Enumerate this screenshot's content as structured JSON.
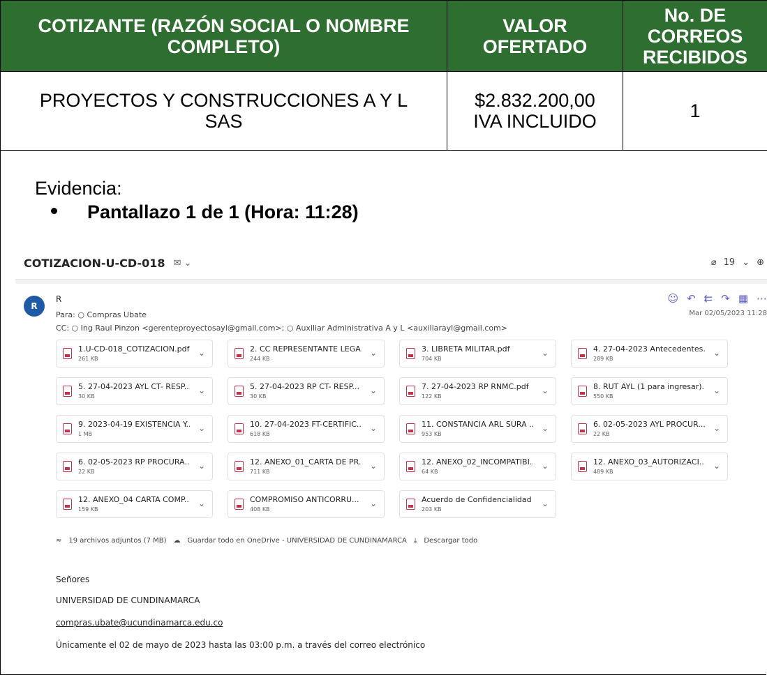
{
  "table": {
    "headers": [
      "COTIZANTE (RAZÓN SOCIAL O NOMBRE COMPLETO)",
      "VALOR OFERTADO",
      "No. DE CORREOS RECIBIDOS"
    ],
    "row": {
      "cotizante": "PROYECTOS Y CONSTRUCCIONES A Y L SAS",
      "valor": "$2.832.200,00 IVA INCLUIDO",
      "correos": "1"
    }
  },
  "evidencia_label": "Evidencia:",
  "bullet": "Pantallazo 1 de 1 (Hora: 11:28)",
  "email": {
    "subject": "COTIZACION-U-CD-018",
    "subject_icon": "envelope-tag-icon",
    "attach_count": "19",
    "avatar_initial": "R",
    "sender": "R",
    "to": "Para: ○ Compras Ubate",
    "cc": "CC: ○ Ing Raul Pinzon <gerenteproyectosayl@gmail.com>; ○ Auxiliar Administrativa A y L <auxiliarayl@gmail.com>",
    "date": "Mar 02/05/2023 11:28",
    "attachments": [
      {
        "name": "1.U-CD-018_COTIZACION.pdf",
        "size": "261 KB"
      },
      {
        "name": "2. CC REPRESENTANTE LEGA...",
        "size": "244 KB"
      },
      {
        "name": "3. LIBRETA MILITAR.pdf",
        "size": "704 KB"
      },
      {
        "name": "4. 27-04-2023 Antecedentes...",
        "size": "289 KB"
      },
      {
        "name": "5. 27-04-2023 AYL CT- RESP...",
        "size": "30 KB"
      },
      {
        "name": "5. 27-04-2023 RP CT- RESP...",
        "size": "30 KB"
      },
      {
        "name": "7. 27-04-2023 RP RNMC.pdf",
        "size": "122 KB"
      },
      {
        "name": "8. RUT AYL (1 para ingresar)....",
        "size": "550 KB"
      },
      {
        "name": "9. 2023-04-19 EXISTENCIA Y...",
        "size": "1 MB"
      },
      {
        "name": "10. 27-04-2023 FT-CERTIFIC...",
        "size": "618 KB"
      },
      {
        "name": "11. CONSTANCIA ARL SURA ...",
        "size": "953 KB"
      },
      {
        "name": "6. 02-05-2023 AYL PROCUR...",
        "size": "22 KB"
      },
      {
        "name": "6. 02-05-2023 RP PROCURA...",
        "size": "22 KB"
      },
      {
        "name": "12. ANEXO_01_CARTA DE PR...",
        "size": "711 KB"
      },
      {
        "name": "12. ANEXO_02_INCOMPATIBI...",
        "size": "64 KB"
      },
      {
        "name": "12. ANEXO_03_AUTORIZACI...",
        "size": "489 KB"
      },
      {
        "name": "12. ANEXO_04 CARTA COMP...",
        "size": "159 KB"
      },
      {
        "name": "COMPROMISO ANTICORRU...",
        "size": "408 KB"
      },
      {
        "name": "Acuerdo de Confidencialidad ...",
        "size": "203 KB"
      }
    ],
    "summary": {
      "count": "19 archivos adjuntos (7 MB)",
      "onedrive": "Guardar todo en OneDrive - UNIVERSIDAD DE CUNDINAMARCA",
      "download": "Descargar todo"
    },
    "body": {
      "line1": "Señores",
      "line2": "UNIVERSIDAD DE CUNDINAMARCA",
      "link": "compras.ubate@ucundinamarca.edu.co",
      "line4": "Únicamente el 02 de mayo de 2023 hasta las 03:00 p.m. a través del correo electrónico"
    }
  }
}
